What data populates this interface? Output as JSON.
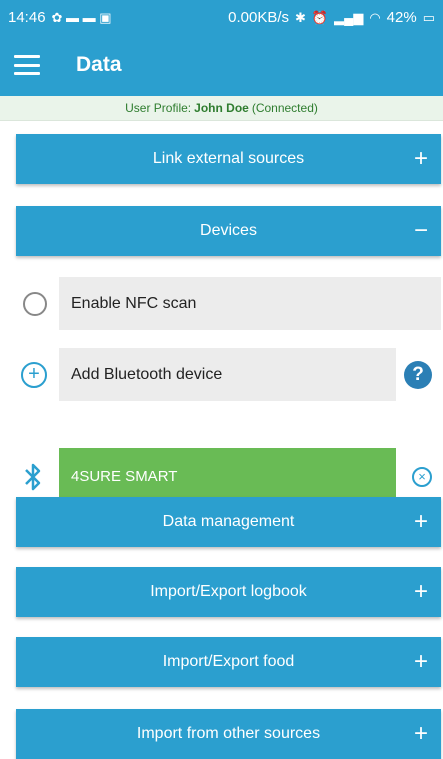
{
  "status_bar": {
    "time": "14:46",
    "network_speed": "0.00KB/s",
    "battery": "42%"
  },
  "app_bar": {
    "title": "Data"
  },
  "profile": {
    "prefix": "User Profile:",
    "name": "John Doe",
    "status": "(Connected)"
  },
  "sections": {
    "link_external": {
      "label": "Link external sources",
      "sign": "+"
    },
    "devices": {
      "label": "Devices",
      "sign": "−"
    },
    "data_management": {
      "label": "Data management",
      "sign": "+"
    },
    "import_export_logbook": {
      "label": "Import/Export logbook",
      "sign": "+"
    },
    "import_export_food": {
      "label": "Import/Export food",
      "sign": "+"
    },
    "import_other": {
      "label": "Import from other sources",
      "sign": "+"
    }
  },
  "devices": {
    "nfc_label": "Enable NFC scan",
    "add_bluetooth_label": "Add Bluetooth device",
    "help_glyph": "?",
    "connected_device": "4SURE SMART",
    "add_glyph": "+",
    "remove_glyph": "×"
  },
  "colors": {
    "primary": "#2b9fcf",
    "device_green": "#69bb55",
    "profile_text": "#2f7d2f"
  }
}
